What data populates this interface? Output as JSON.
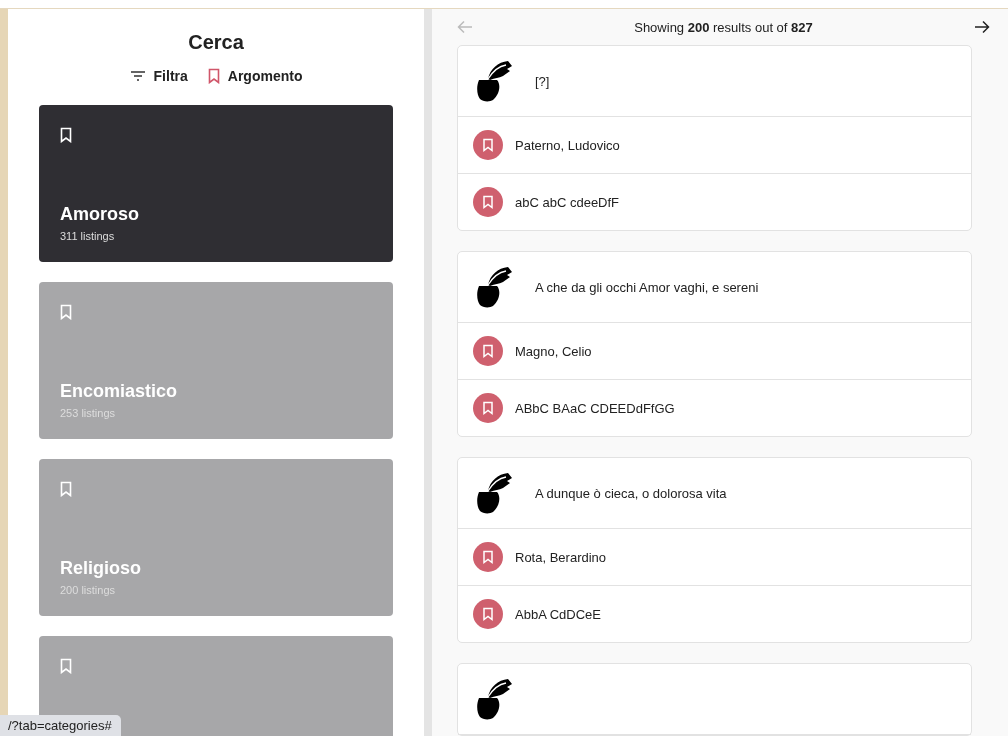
{
  "sidebar": {
    "title": "Cerca",
    "toolbar": [
      {
        "label": "Filtra",
        "kind": "filter"
      },
      {
        "label": "Argomento",
        "kind": "topic"
      }
    ],
    "categories": [
      {
        "title": "Amoroso",
        "count": "311 listings",
        "selected": true
      },
      {
        "title": "Encomiastico",
        "count": "253 listings",
        "selected": false
      },
      {
        "title": "Religioso",
        "count": "200 listings",
        "selected": false
      },
      {
        "selected": false
      }
    ]
  },
  "results": {
    "prev": {
      "disabled": true
    },
    "summary": "Showing **200** results out of **827**",
    "next": {
      "disabled": false
    },
    "items": [
      {
        "kind": "poem",
        "title": "[?]",
        "author": "Paterno, Ludovico",
        "scheme": "abC abC cdeeDfF"
      },
      {
        "kind": "poem",
        "title": "A che da gli occhi Amor vaghi, e sereni",
        "author": "Magno, Celio",
        "scheme": "ABbC BAaC CDEEDdFfGG"
      },
      {
        "kind": "poem",
        "title": "A dunque ò cieca, o dolorosa vita",
        "author": "Rota, Berardino",
        "scheme": "AbbA CdDCeE"
      },
      {
        "kind": "poem"
      }
    ]
  },
  "status_bar": {
    "url": "/?tab=categories#"
  }
}
